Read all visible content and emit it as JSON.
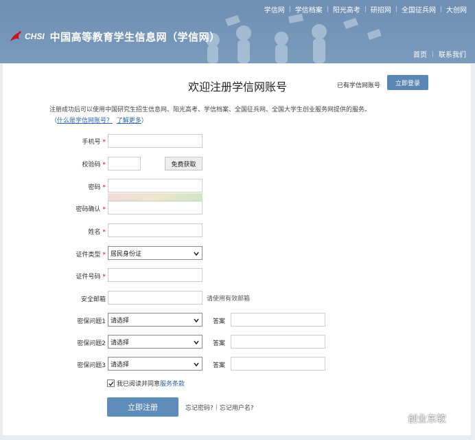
{
  "header": {
    "top_nav": [
      "学信网",
      "学信档案",
      "阳光高考",
      "研招网",
      "全国征兵网",
      "大创网"
    ],
    "logo_text": "CHSI",
    "site_name": "中国高等教育学生信息网（学信网）",
    "sub_nav": [
      "首页",
      "联系我们"
    ],
    "bg_color": "#7495b8"
  },
  "page": {
    "title": "欢迎注册学信网账号",
    "have_account": "已有学信网账号",
    "login_button": "立即登录",
    "intro": "注册成功后可以使用中国研究生招生信息网、阳光高考、学信档案、全国征兵网、全国大学生创业服务网提供的服务。",
    "link_open": "（",
    "link_what": "什么是学信网账号？",
    "link_more": "了解更多",
    "link_close": "）"
  },
  "form": {
    "required_mark": "*",
    "phone_label": "手机号",
    "code_label": "校验码",
    "get_code_button": "免费获取",
    "password_label": "密码",
    "password_confirm_label": "密码确认",
    "name_label": "姓名",
    "id_type_label": "证件类型",
    "id_type_value": "居民身份证",
    "id_number_label": "证件号码",
    "email_label": "安全邮箱",
    "email_hint": "请使用有效邮箱",
    "questions": [
      {
        "label": "密保问题1",
        "value": "请选择",
        "answer_label": "答案"
      },
      {
        "label": "密保问题2",
        "value": "请选择",
        "answer_label": "答案"
      },
      {
        "label": "密保问题3",
        "value": "请选择",
        "answer_label": "答案"
      }
    ],
    "agree_prefix": "我已阅读并同意",
    "agree_terms": "服务条款",
    "agree_checked": true,
    "register_button": "立即注册",
    "forgot_password": "忘记密码?",
    "separator": "|",
    "forgot_username": "忘记用户名?"
  },
  "watermark": {
    "text": "创业东软",
    "icon": "wechat-icon"
  },
  "colors": {
    "accent_button": "#5f8db9",
    "link": "#2d64a8",
    "required": "#d0021b"
  }
}
